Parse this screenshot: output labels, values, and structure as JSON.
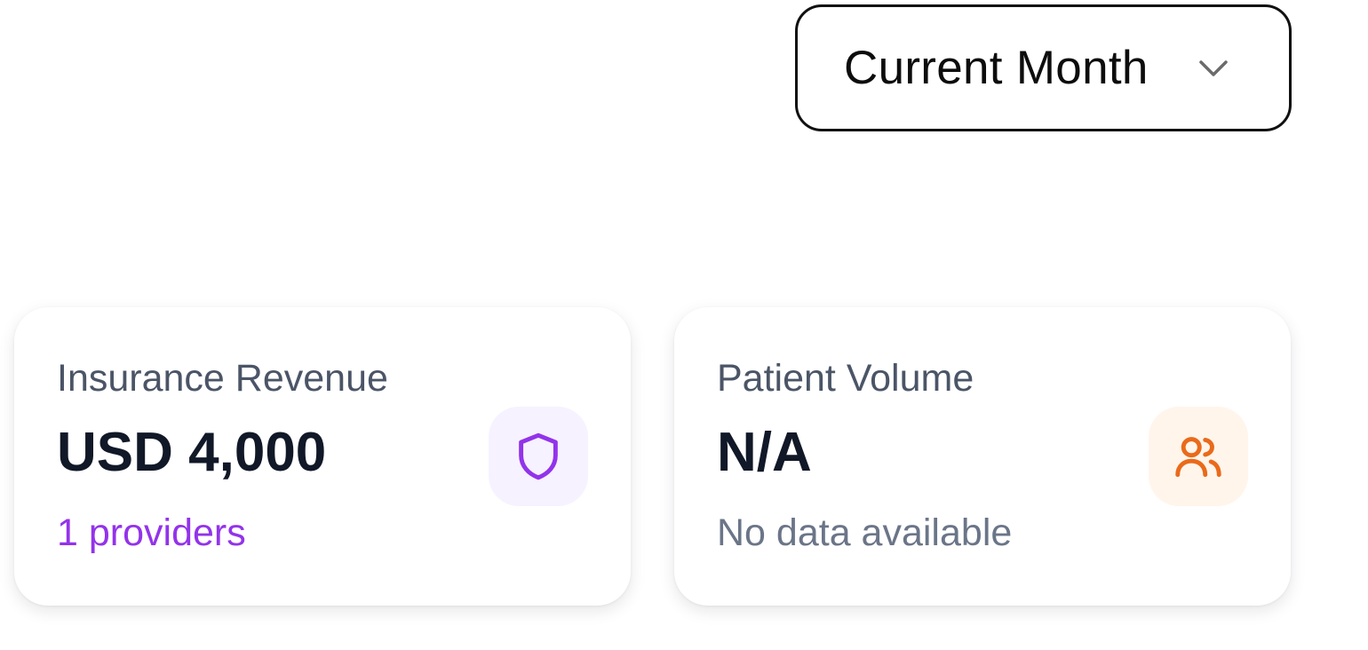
{
  "filter": {
    "period_label": "Current Month",
    "icon": "chevron-down-icon"
  },
  "cards": [
    {
      "title": "Insurance Revenue",
      "value": "USD 4,000",
      "subtitle": "1 providers",
      "icon": "shield-icon",
      "accent_color": "#9333ea",
      "icon_bg": "#f6f2ff"
    },
    {
      "title": "Patient Volume",
      "value": "N/A",
      "subtitle": "No data available",
      "icon": "users-icon",
      "accent_color": "#ea6a1a",
      "icon_bg": "#fff5eb"
    }
  ]
}
